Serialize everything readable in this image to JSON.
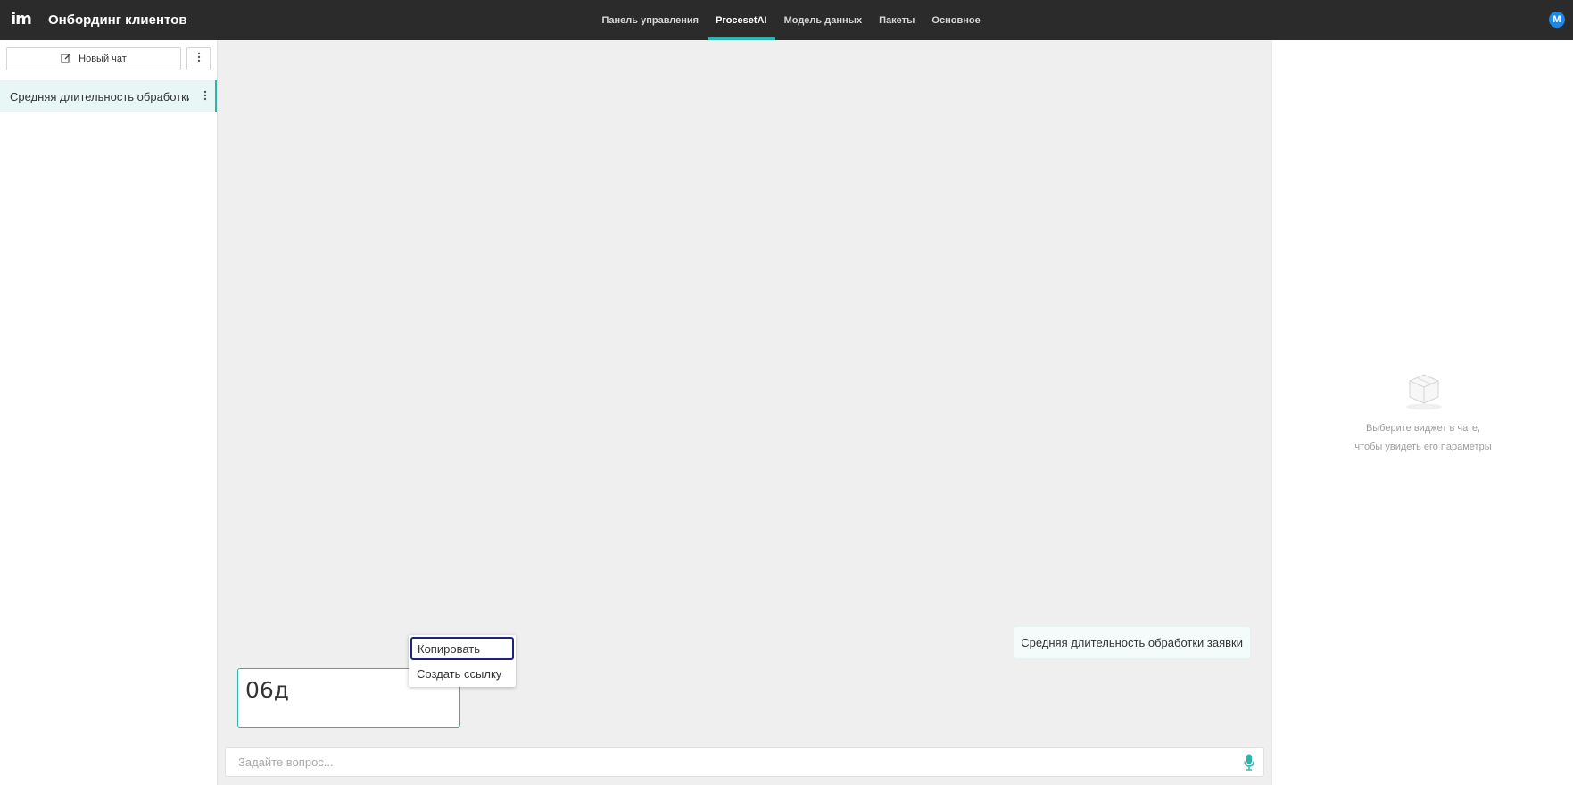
{
  "header": {
    "logo": "im",
    "title": "Онбординг клиентов",
    "tabs": [
      {
        "label": "Панель управления",
        "active": false
      },
      {
        "label": "ProcesetAI",
        "active": true
      },
      {
        "label": "Модель данных",
        "active": false
      },
      {
        "label": "Пакеты",
        "active": false
      },
      {
        "label": "Основное",
        "active": false
      }
    ],
    "avatar_initial": "M"
  },
  "sidebar": {
    "new_chat_label": "Новый чат",
    "chats": [
      {
        "label": "Средняя длительность обработки заявки",
        "selected": true
      }
    ]
  },
  "chat": {
    "user_message": "Средняя длительность обработки заявки",
    "answer_value": "06д",
    "context_menu": [
      "Копировать",
      "Создать ссылку"
    ],
    "input_placeholder": "Задайте вопрос..."
  },
  "right_panel": {
    "empty_line1": "Выберите виджет в чате,",
    "empty_line2": "чтобы увидеть его параметры"
  },
  "colors": {
    "accent": "#2bb5ad",
    "topbar": "#2b2b2b",
    "avatar": "#1e88e5",
    "focus": "#1a237e"
  },
  "icons": [
    "edit-icon",
    "more-vertical-icon",
    "microphone-icon",
    "empty-box-icon"
  ]
}
